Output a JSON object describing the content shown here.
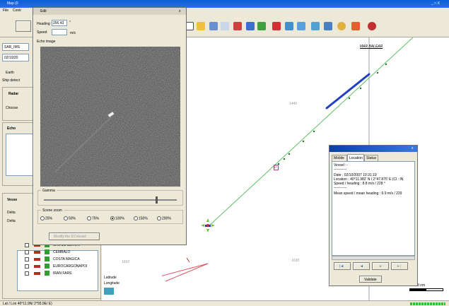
{
  "app": {
    "title": "Map (0",
    "menu": [
      "File",
      "Contr"
    ],
    "window_controls": "_ □ X"
  },
  "left_panel": {
    "fields": [
      "SAR_IMS",
      "02/10/20"
    ],
    "earth_tab": "Earth",
    "ship_detect": "Ship detect",
    "radar_header": "Radar",
    "radar_choose": "Choose",
    "echo_header": "Echo",
    "vessel_header": "Vesse",
    "delta1": "Delta",
    "delta2": "Delta"
  },
  "vessels": [
    {
      "name": "CAVALL SERVAT"
    },
    {
      "name": "CEMBALO"
    },
    {
      "name": "COSTA MAGICA"
    },
    {
      "name": "EUROCARGONAPOI"
    },
    {
      "name": "IRAN FARS"
    }
  ],
  "latlon": {
    "lat_label": "Latitude",
    "lon_label": "Longitude"
  },
  "status_bar": {
    "text": "Lat / Lon   40°11.9N/  2°55.9E/ E)"
  },
  "echo_dialog": {
    "title": "Edit",
    "heading_label": "Heading",
    "heading_value": "256.43",
    "heading_unit": "°",
    "speed_label": "Speed",
    "speed_value": "",
    "speed_unit": "m/s",
    "echo_image_label": "Echo image",
    "gamma_label": "Gamma",
    "gamma_level": 0.84,
    "zoom_label": "Scene zoom",
    "zoom_options": [
      "25%",
      "50%",
      "75%",
      "100%",
      "150%",
      "200%"
    ],
    "zoom_selected": "100%",
    "modify_button": "Modify the ECVessel"
  },
  "map": {
    "label_top": "MAR BALEAR",
    "depth_labels": [
      "1446",
      "1662",
      "1630"
    ],
    "scale": "3 nm",
    "marker_label": "D"
  },
  "info_dialog": {
    "tabs": [
      "Mobile",
      "Location",
      "Status"
    ],
    "active_tab": "Location",
    "vessel_line": "Vessel :",
    "vessel_value": "-",
    "sep": "-----------",
    "date_line": "Date : 02/10/2007 10:31:19",
    "location_line": "Location : 40°11.982' N / 2°47.875' E (Cl : IN",
    "speed_line": "Speed / heading : 8.8 m/s / 228 °",
    "sep2": "-----------",
    "mean_line": "Mean speed / mean heading : 9.9 m/s / 229",
    "nav_first": "|◄",
    "nav_prev": "◄",
    "nav_next": "►",
    "nav_last": "►|",
    "validate": "Validate"
  }
}
